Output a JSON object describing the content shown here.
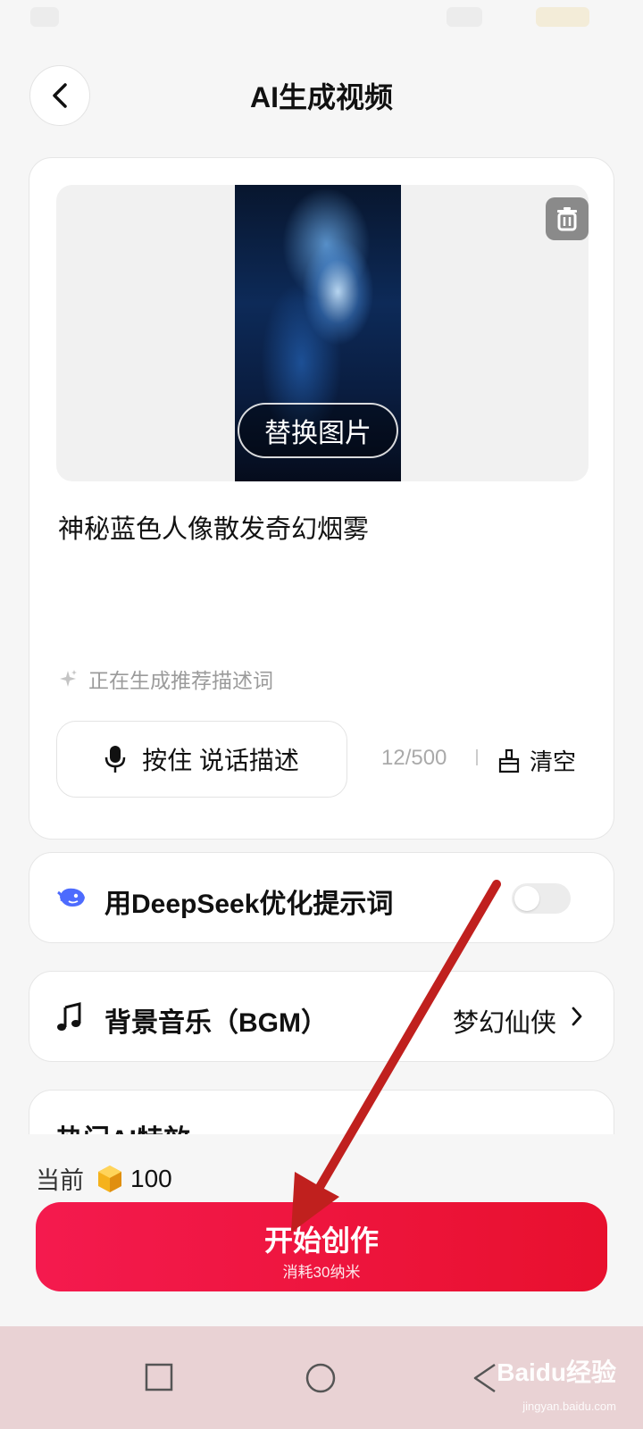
{
  "header": {
    "title": "AI生成视频"
  },
  "editor": {
    "replace_image_label": "替换图片",
    "prompt_text": "神秘蓝色人像散发奇幻烟雾",
    "suggest_status": "正在生成推荐描述词",
    "voice_button_label": "按住 说话描述",
    "char_count": "12/500",
    "clear_label": "清空"
  },
  "deepseek": {
    "label": "用DeepSeek优化提示词",
    "enabled": false
  },
  "bgm": {
    "label": "背景音乐（BGM）",
    "value": "梦幻仙侠"
  },
  "effects": {
    "title": "热门AI特效"
  },
  "footer": {
    "balance_label": "当前",
    "balance_amount": "100",
    "create_label": "开始创作",
    "create_cost": "消耗30纳米"
  },
  "watermark": {
    "brand": "Baidu经验",
    "url": "jingyan.baidu.com"
  },
  "colors": {
    "accent": "#ee1540",
    "annotation_arrow": "#c0201e"
  }
}
